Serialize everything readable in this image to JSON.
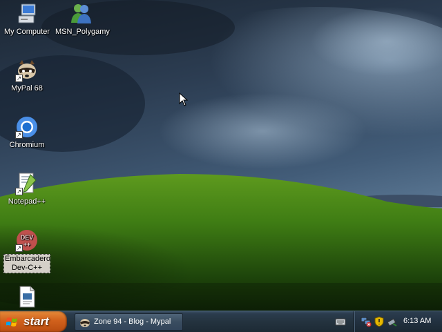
{
  "desktop": {
    "icons": [
      {
        "label": "My Computer",
        "icon": "my-computer-icon"
      },
      {
        "label": "MSN_Polygamy",
        "icon": "msn-messenger-icon"
      },
      {
        "label": "MyPal 68",
        "icon": "mypal-raccoon-icon"
      },
      {
        "label": "Chromium",
        "icon": "chromium-icon"
      },
      {
        "label": "Notepad++",
        "icon": "notepad-plus-plus-icon"
      },
      {
        "label": "Embarcadero Dev-C++",
        "icon": "dev-cpp-icon",
        "selected": true
      },
      {
        "label": "",
        "icon": "document-file-icon"
      }
    ],
    "wallpaper": "bliss-stormy"
  },
  "taskbar": {
    "start_label": "start",
    "tasks": [
      {
        "label": "Zone 94 - Blog - Mypal",
        "icon": "mypal-raccoon-icon"
      }
    ],
    "tray": {
      "icons": [
        "network-warning-icon",
        "security-shield-icon",
        "safely-remove-hardware-icon"
      ],
      "clock": "6:13 AM"
    }
  },
  "colors": {
    "start_button": "#d1611c",
    "taskbar": "#24333f",
    "selected_label_bg": "#d4d0c8"
  }
}
